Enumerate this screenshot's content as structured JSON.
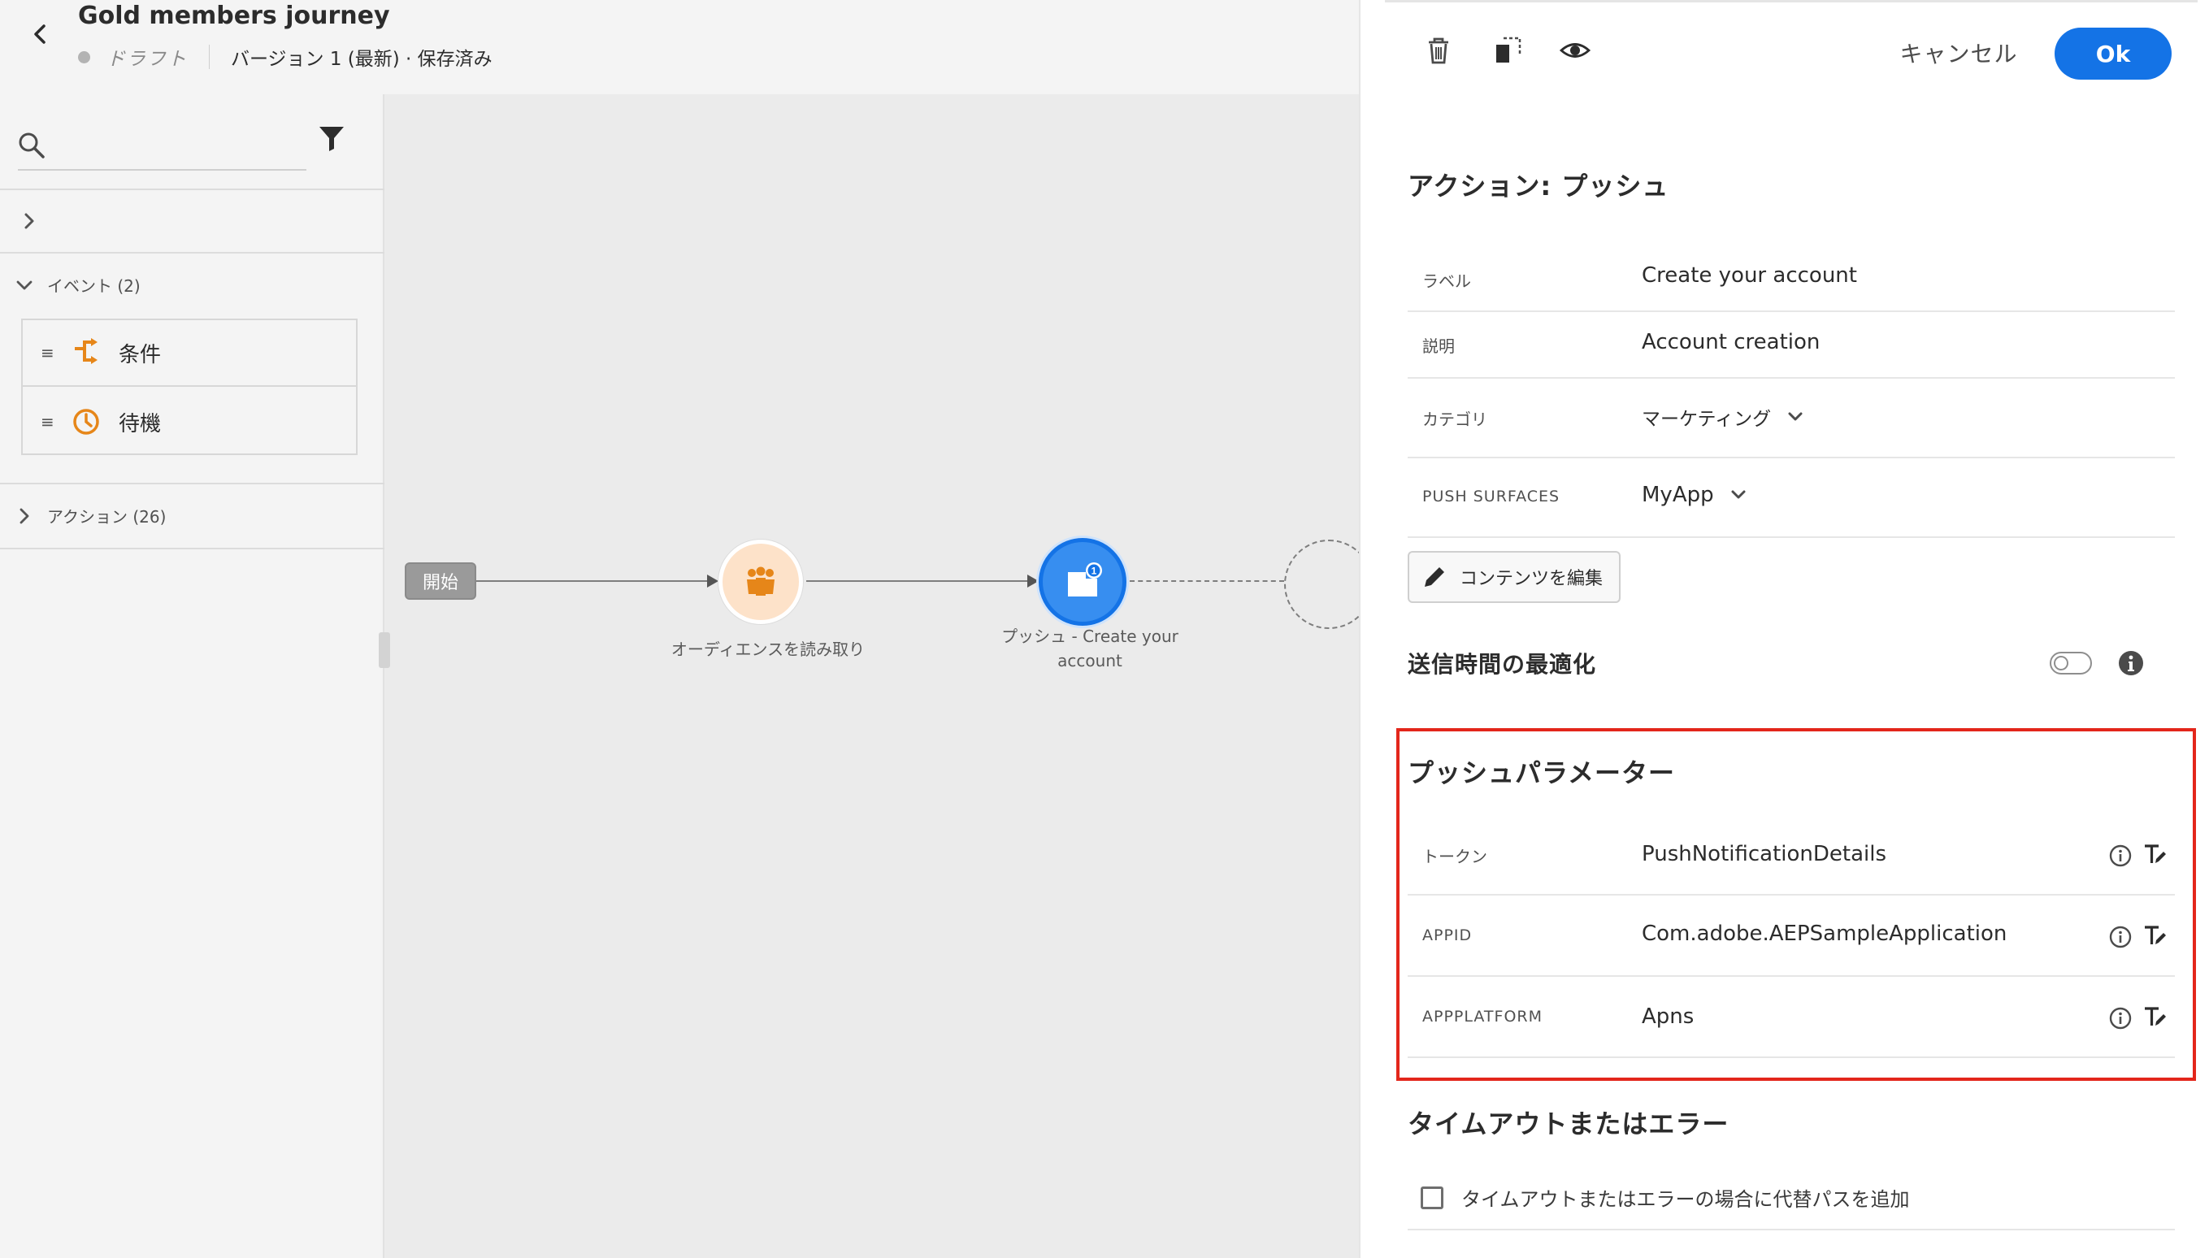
{
  "header": {
    "title": "Gold members journey",
    "status": "ドラフト",
    "version": "バージョン 1 (最新) · 保存済み"
  },
  "sidebar": {
    "search": {
      "placeholder": "",
      "value": ""
    },
    "categories": {
      "events": "イベント (2)",
      "actions": "アクション (26)"
    },
    "items": [
      {
        "label": "条件",
        "icon": "condition-icon"
      },
      {
        "label": "待機",
        "icon": "clock-icon"
      }
    ]
  },
  "canvas": {
    "start_label": "開始",
    "nodes": [
      {
        "label": "オーディエンスを読み取り",
        "icon": "audience-icon"
      },
      {
        "label_line1": "プッシュ - Create your",
        "label_line2": "account",
        "icon": "push-icon",
        "badge": "1"
      }
    ]
  },
  "panel": {
    "toolbar": {
      "cancel": "キャンセル",
      "ok": "Ok"
    },
    "action_title": "アクション: プッシュ",
    "fields": {
      "label": {
        "name": "ラベル",
        "value": "Create your account"
      },
      "description": {
        "name": "説明",
        "value": "Account creation"
      },
      "category": {
        "name": "カテゴリ",
        "value": "マーケティング"
      },
      "push_surfaces": {
        "name": "PUSH SURFACES",
        "value": "MyApp"
      }
    },
    "edit_content": "コンテンツを編集",
    "send_time_optimization": {
      "label": "送信時間の最適化",
      "enabled": false
    },
    "push_params": {
      "title": "プッシュパラメーター",
      "rows": [
        {
          "name": "トークン",
          "value": "PushNotificationDetails"
        },
        {
          "name": "APPID",
          "value": "Com.adobe.AEPSampleApplication"
        },
        {
          "name": "APPPLATFORM",
          "value": "Apns"
        }
      ]
    },
    "timeout": {
      "title": "タイムアウトまたはエラー",
      "checkbox_label": "タイムアウトまたはエラーの場合に代替パスを追加",
      "checked": false
    }
  },
  "colors": {
    "accent": "#1473e6",
    "push_node": "#378ef0",
    "audience_node": "#fde2c9",
    "event_icon": "#e68619",
    "highlight": "#e3261b"
  }
}
